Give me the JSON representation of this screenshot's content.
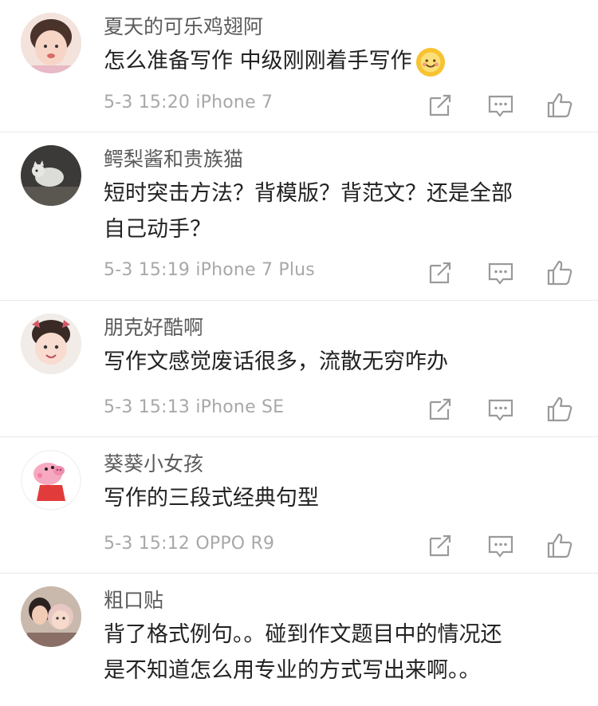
{
  "comments": [
    {
      "username": "夏天的可乐鸡翅阿",
      "text_lines": [
        "怎么准备写作 中级刚刚着手写作"
      ],
      "emoji": "smiling-sun-emoji",
      "date": "5-3 15:20",
      "device": "iPhone 7",
      "avatar": "child-photo-avatar"
    },
    {
      "username": "鳄梨酱和贵族猫",
      "text_lines": [
        "短时突击方法？背模版？背范文？还是全部",
        "自己动手？"
      ],
      "date": "5-3 15:19",
      "device": "iPhone 7 Plus",
      "avatar": "cat-photo-avatar"
    },
    {
      "username": "朋克好酷啊",
      "text_lines": [
        "写作文感觉废话很多，流散无穷咋办"
      ],
      "date": "5-3 15:13",
      "device": "iPhone SE",
      "avatar": "baby-photo-avatar"
    },
    {
      "username": "葵葵小女孩",
      "text_lines": [
        "写作的三段式经典句型"
      ],
      "date": "5-3 15:12",
      "device": "OPPO R9",
      "avatar": "pig-cartoon-avatar"
    },
    {
      "username": "粗口贴",
      "text_lines": [
        "背了格式例句。。碰到作文题目中的情况还",
        "是不知道怎么用专业的方式写出来啊。。"
      ],
      "date": "",
      "device": "",
      "avatar": "mother-child-photo-avatar"
    }
  ]
}
